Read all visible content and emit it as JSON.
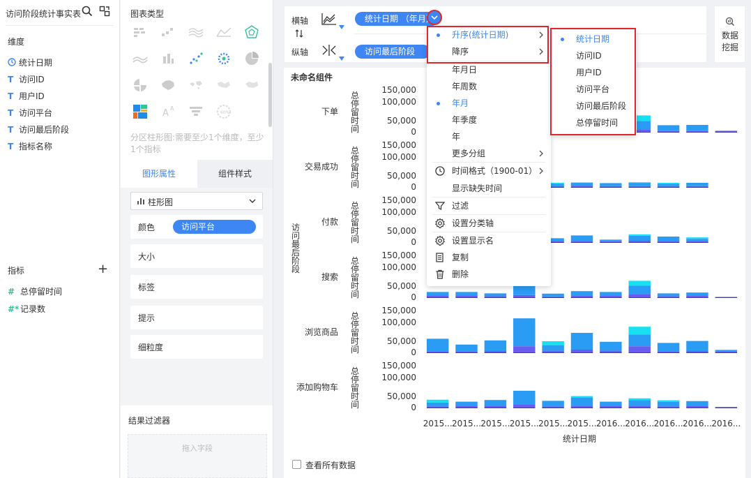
{
  "left": {
    "title": "访问阶段统计事实表",
    "dim_label": "维度",
    "dims": [
      {
        "icon": "clock-icon",
        "label": "统计日期"
      },
      {
        "icon": "text-type-icon",
        "label": "访问ID"
      },
      {
        "icon": "text-type-icon",
        "label": "用户ID"
      },
      {
        "icon": "text-type-icon",
        "label": "访问平台"
      },
      {
        "icon": "text-type-icon",
        "label": "访问最后阶段"
      },
      {
        "icon": "text-type-icon",
        "label": "指标名称"
      }
    ],
    "metric_label": "指标",
    "metrics": [
      {
        "icon": "#",
        "label": "总停留时间"
      },
      {
        "icon": "#*",
        "label": "记录数"
      }
    ],
    "type_glyph": "T"
  },
  "middle": {
    "chart_type_title": "图表类型",
    "hint": "分区柱形图:需要至少1个维度，至少1个指标",
    "tab_props": "图形属性",
    "tab_style": "组件样式",
    "select_value": "柱形图",
    "color_label": "颜色",
    "color_pill": "访问平台",
    "size_label": "大小",
    "tag_label": "标签",
    "tip_label": "提示",
    "gran_label": "细粒度",
    "result_filter": "结果过滤器",
    "drop_hint": "拖入字段"
  },
  "axis": {
    "x_label": "横轴",
    "y_label": "纵轴",
    "x_pill": "统计日期 （年月）",
    "y_pill": "访问最后阶段",
    "mining": "数据挖掘"
  },
  "menu1": {
    "items": [
      {
        "label": "升序(统计日期)",
        "sel": true,
        "arrow": true
      },
      {
        "label": "降序",
        "arrow": true
      },
      {
        "label": "年月日"
      },
      {
        "label": "年周数"
      },
      {
        "label": "年月",
        "sel": true
      },
      {
        "label": "年季度"
      },
      {
        "label": "年"
      },
      {
        "label": "更多分组",
        "arrow": true
      },
      {
        "label": "时间格式（1900-01）",
        "arrow": true,
        "icon": "clock-icon"
      },
      {
        "label": "显示缺失时间"
      },
      {
        "label": "过滤",
        "icon": "filter-icon"
      },
      {
        "label": "设置分类轴",
        "icon": "gear-icon"
      },
      {
        "label": "设置显示名",
        "icon": "gear-icon"
      },
      {
        "label": "复制",
        "icon": "copy-icon"
      },
      {
        "label": "删除",
        "icon": "trash-icon"
      }
    ]
  },
  "menu2": {
    "items": [
      {
        "label": "统计日期",
        "sel": true
      },
      {
        "label": "访问ID"
      },
      {
        "label": "用户ID"
      },
      {
        "label": "访问平台"
      },
      {
        "label": "访问最后阶段"
      },
      {
        "label": "总停留时间"
      }
    ]
  },
  "bottom": {
    "view_all": "查看所有数据"
  },
  "colors": {
    "accent": "#3d86f4",
    "bar_blue": "#2b9cf4",
    "bar_purple": "#6a5cf0",
    "bar_cyan": "#18e0f0",
    "red": "#e0262d"
  },
  "chart_data": {
    "type": "bar",
    "title": "未命名组件",
    "xlabel": "统计日期",
    "ylabel_outer": "访问最后阶段",
    "ylabel_inner": "总停留时间",
    "categories": [
      "2015...",
      "2015...",
      "2015...",
      "2015...",
      "2015...",
      "2015...",
      "2016...",
      "2016...",
      "2016...",
      "2016...",
      "2016..."
    ],
    "yticks": [
      "0",
      "50,000",
      "100,000",
      "150,000"
    ],
    "ylim": [
      0,
      150000
    ],
    "stacked": true,
    "series_colors": [
      "#6a5cf0",
      "#2b9cf4",
      "#18e0f0"
    ],
    "panels": [
      {
        "name": "下单",
        "values": [
          [
            3000,
            12000,
            0
          ],
          [
            3000,
            11000,
            0
          ],
          [
            3000,
            10000,
            0
          ],
          [
            6000,
            28000,
            5000
          ],
          [
            4000,
            9000,
            3000
          ],
          [
            3000,
            14000,
            0
          ],
          [
            4000,
            16000,
            4000
          ],
          [
            9000,
            30000,
            20000
          ],
          [
            3000,
            21000,
            0
          ],
          [
            3000,
            22000,
            0
          ],
          [
            4000,
            0,
            0
          ]
        ]
      },
      {
        "name": "交易成功",
        "values": [
          [
            3000,
            12000,
            0
          ],
          [
            3000,
            10000,
            0
          ],
          [
            3000,
            11000,
            0
          ],
          [
            5000,
            20000,
            0
          ],
          [
            3000,
            9000,
            3000
          ],
          [
            4000,
            12000,
            0
          ],
          [
            3000,
            11000,
            0
          ],
          [
            3000,
            12000,
            2000
          ],
          [
            3000,
            9000,
            3000
          ],
          [
            3000,
            12000,
            0
          ],
          [
            0,
            0,
            0
          ]
        ]
      },
      {
        "name": "付款",
        "values": [
          [
            3000,
            14000,
            0
          ],
          [
            3000,
            12000,
            0
          ],
          [
            3000,
            14000,
            0
          ],
          [
            5000,
            18000,
            0
          ],
          [
            4000,
            10000,
            0
          ],
          [
            4000,
            20000,
            0
          ],
          [
            3000,
            6000,
            0
          ],
          [
            5000,
            18000,
            5000
          ],
          [
            4000,
            16000,
            0
          ],
          [
            4000,
            8000,
            5000
          ],
          [
            0,
            0,
            0
          ]
        ]
      },
      {
        "name": "搜索",
        "values": [
          [
            5000,
            14000,
            0
          ],
          [
            5000,
            14000,
            0
          ],
          [
            4000,
            10000,
            0
          ],
          [
            8000,
            38000,
            0
          ],
          [
            3000,
            10000,
            0
          ],
          [
            6000,
            16000,
            0
          ],
          [
            5000,
            14000,
            0
          ],
          [
            12000,
            30000,
            17000
          ],
          [
            4000,
            10000,
            0
          ],
          [
            5000,
            12000,
            0
          ],
          [
            0,
            0,
            2000
          ]
        ]
      },
      {
        "name": "浏览商品",
        "values": [
          [
            4000,
            45000,
            0
          ],
          [
            4000,
            24000,
            0
          ],
          [
            5000,
            38000,
            0
          ],
          [
            22000,
            100000,
            0
          ],
          [
            6000,
            20000,
            14000
          ],
          [
            10000,
            60000,
            0
          ],
          [
            6000,
            32000,
            0
          ],
          [
            22000,
            42000,
            28000
          ],
          [
            4000,
            30000,
            0
          ],
          [
            5000,
            36000,
            0
          ],
          [
            4000,
            5000,
            0
          ]
        ]
      },
      {
        "name": "添加购物车",
        "values": [
          [
            4000,
            14000,
            10000
          ],
          [
            5000,
            16000,
            0
          ],
          [
            5000,
            22000,
            0
          ],
          [
            10000,
            50000,
            0
          ],
          [
            4000,
            20000,
            0
          ],
          [
            5000,
            30000,
            6000
          ],
          [
            5000,
            16000,
            0
          ],
          [
            5000,
            22000,
            6000
          ],
          [
            4000,
            16000,
            6000
          ],
          [
            5000,
            18000,
            0
          ],
          [
            2000,
            0,
            0
          ]
        ]
      }
    ]
  }
}
